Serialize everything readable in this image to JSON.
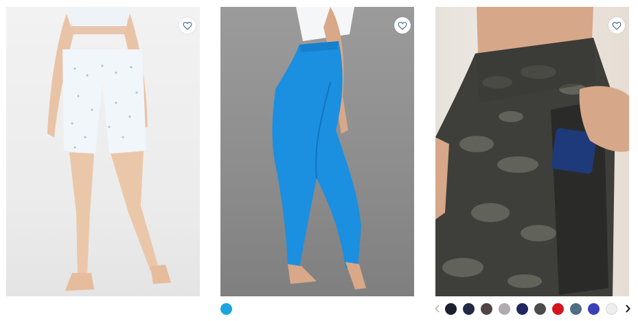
{
  "products": [
    {
      "id_label": "product-1",
      "image_alt": "",
      "favorite_icon": "heart-outline-icon",
      "swatches": []
    },
    {
      "id_label": "product-2",
      "image_alt": "",
      "favorite_icon": "heart-outline-icon",
      "swatches": [
        {
          "color": "#1aa5e0",
          "selected": true
        }
      ]
    },
    {
      "id_label": "product-3",
      "image_alt": "",
      "favorite_icon": "heart-outline-icon",
      "swatches": [
        {
          "color": "#1c1f2e"
        },
        {
          "color": "#232845"
        },
        {
          "color": "#4e4444"
        },
        {
          "color": "#b1abb0"
        },
        {
          "color": "#22265f"
        },
        {
          "color": "#4c4a4a"
        },
        {
          "color": "#d3151e"
        },
        {
          "color": "#4f6e84"
        },
        {
          "color": "#3b3fb8"
        },
        {
          "color": "#eeeeee"
        }
      ],
      "prev_icon": "chevron-left-icon",
      "next_icon": "chevron-right-icon"
    }
  ],
  "colors": {
    "heart_stroke": "#4a6b8a",
    "arrow_inactive": "#b5b5b5",
    "arrow_active": "#111111"
  }
}
